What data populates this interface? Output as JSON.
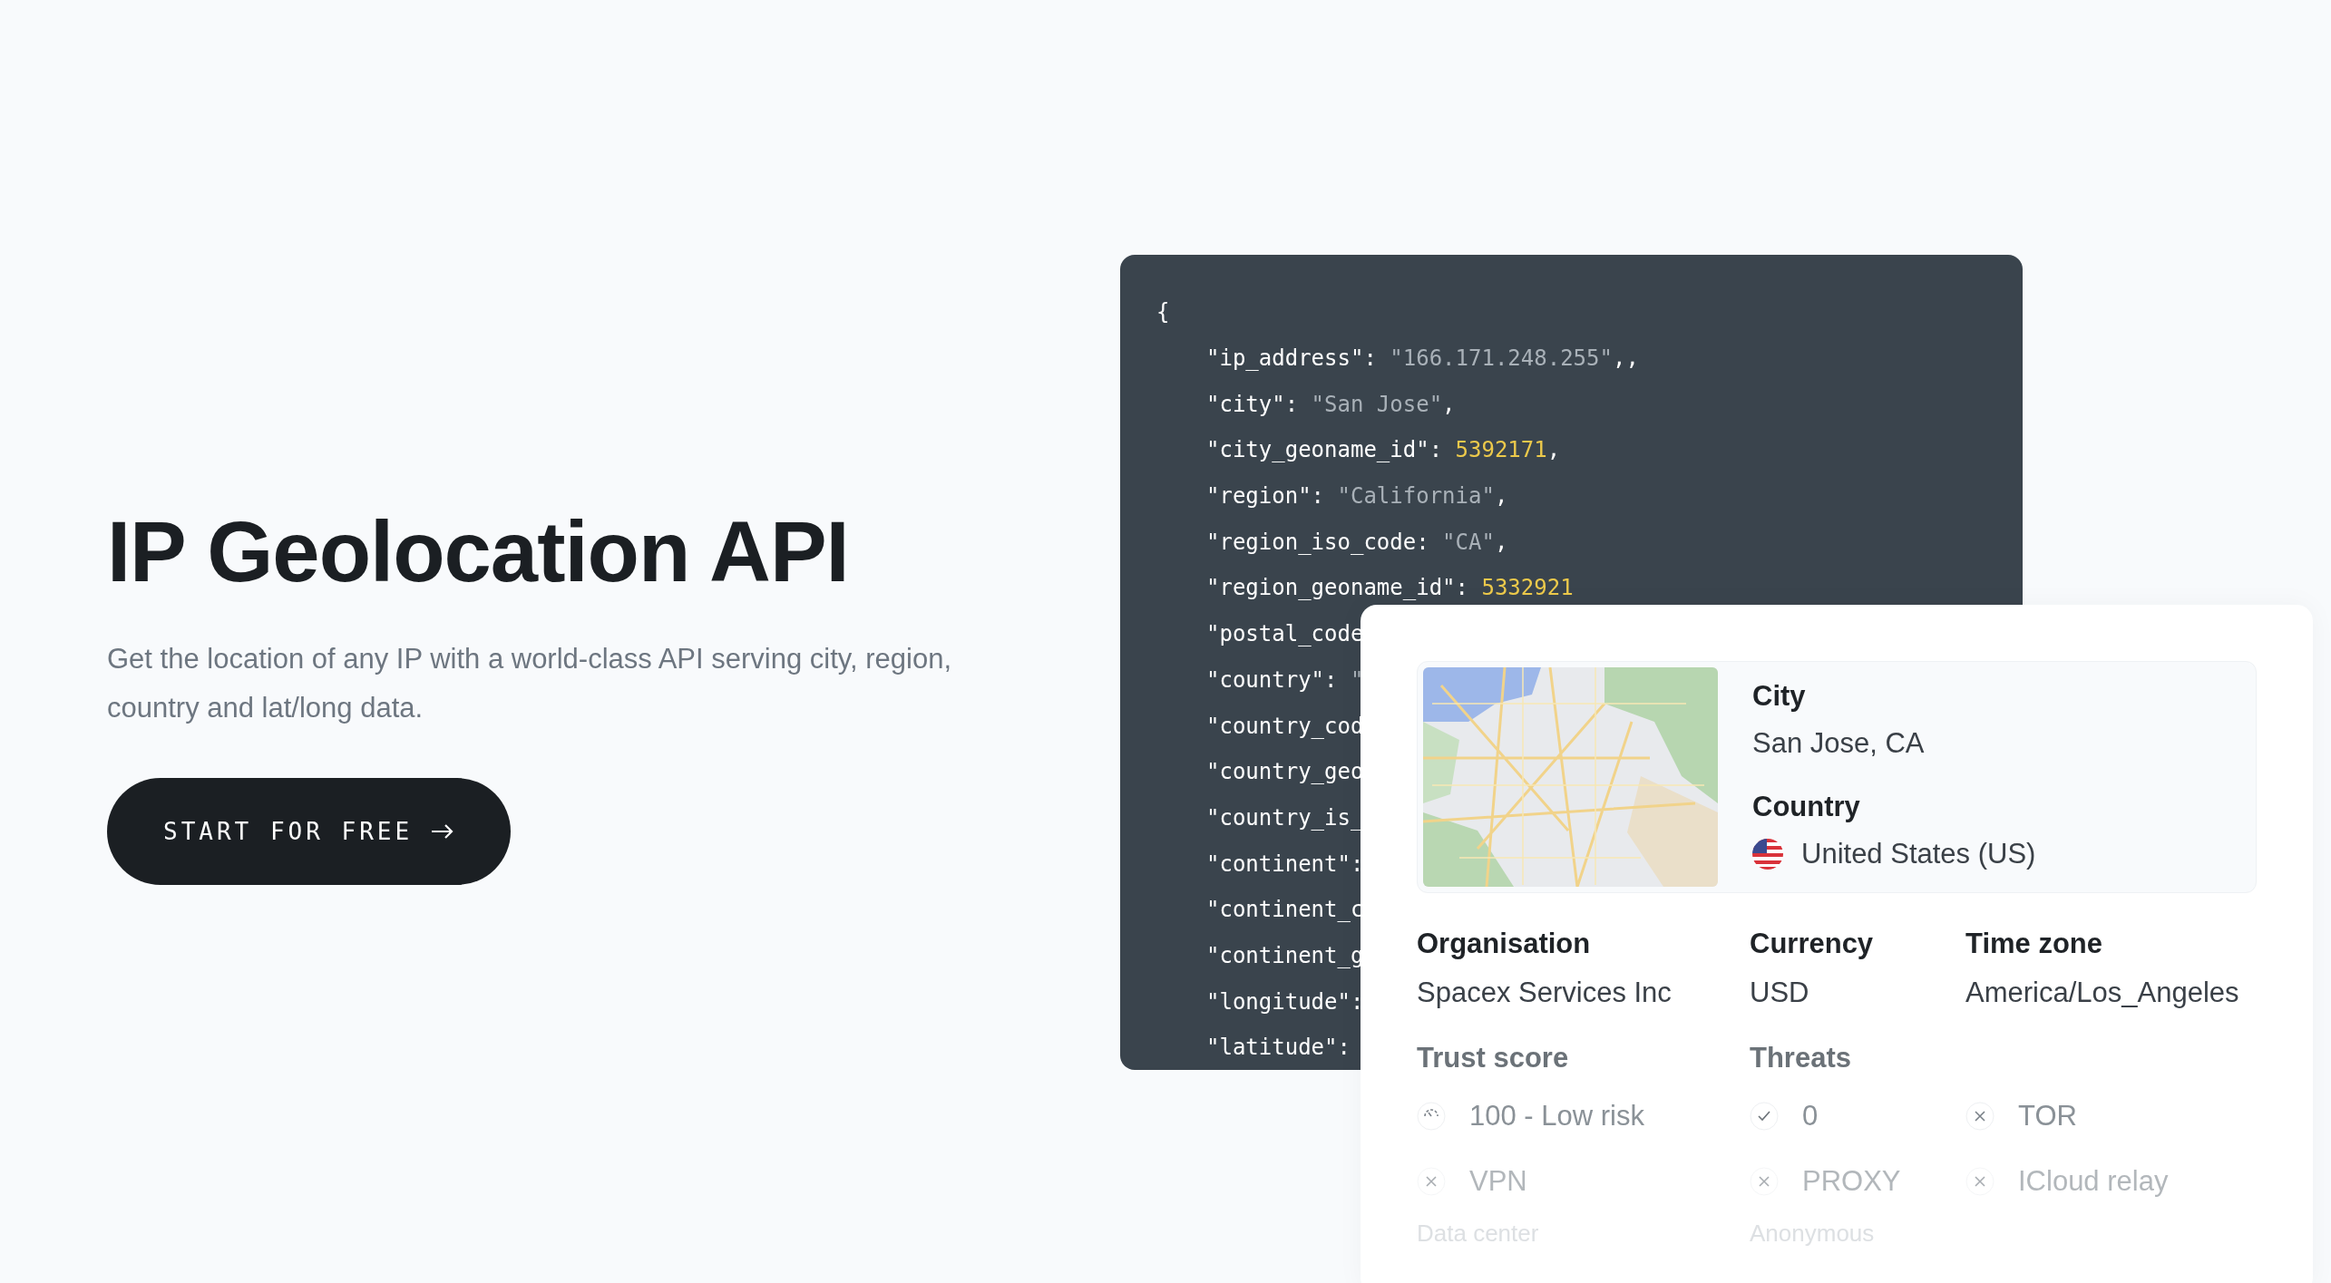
{
  "hero": {
    "title": "IP Geolocation API",
    "subtitle": "Get the location of any IP with a world-class API serving city, region, country and lat/long data.",
    "cta": "START FOR FREE"
  },
  "code": {
    "open": "{",
    "lines": [
      {
        "key": "\"ip_address\": ",
        "value": "\"166.171.248.255\"",
        "kind": "string",
        "tail": ",,"
      },
      {
        "key": "\"city\": ",
        "value": "\"San Jose\"",
        "kind": "string",
        "tail": ","
      },
      {
        "key": "\"city_geoname_id\": ",
        "value": "5392171",
        "kind": "number",
        "tail": ","
      },
      {
        "key": "\"region\": ",
        "value": "\"California\"",
        "kind": "string",
        "tail": ","
      },
      {
        "key": "\"region_iso_code: ",
        "value": "\"CA\"",
        "kind": "string",
        "tail": ","
      },
      {
        "key": "\"region_geoname_id\": ",
        "value": "5332921",
        "kind": "number"
      },
      {
        "key": "\"postal_code"
      },
      {
        "key": "\"country\": ",
        "value": "\"",
        "kind": "string"
      },
      {
        "key": "\"country_cod"
      },
      {
        "key": "\"country_geo"
      },
      {
        "key": "\"country_is_"
      },
      {
        "key": "\"continent\":"
      },
      {
        "key": "\"continent_c"
      },
      {
        "key": "\"continent_g"
      },
      {
        "key": "\"longitude\":"
      },
      {
        "key": "\"latitude\":"
      }
    ]
  },
  "card": {
    "location": {
      "city_label": "City",
      "city": "San Jose, CA",
      "country_label": "Country",
      "country": "United States (US)"
    },
    "facts": [
      {
        "label": "Organisation",
        "value": "Spacex Services Inc"
      },
      {
        "label": "Currency",
        "value": "USD"
      },
      {
        "label": "Time zone",
        "value": "America/Los_Angeles"
      }
    ],
    "section_labels": [
      "Trust score",
      "Threats"
    ],
    "indicator_rows": [
      [
        {
          "kind": "gauge",
          "label": "100 - Low risk"
        },
        {
          "kind": "check",
          "label": "0"
        },
        {
          "kind": "cross",
          "label": "TOR"
        }
      ],
      [
        {
          "kind": "cross",
          "label": "VPN"
        },
        {
          "kind": "cross",
          "label": "PROXY"
        },
        {
          "kind": "cross",
          "label": "ICloud relay"
        }
      ]
    ],
    "more_labels": [
      "Data center",
      "Anonymous"
    ]
  }
}
